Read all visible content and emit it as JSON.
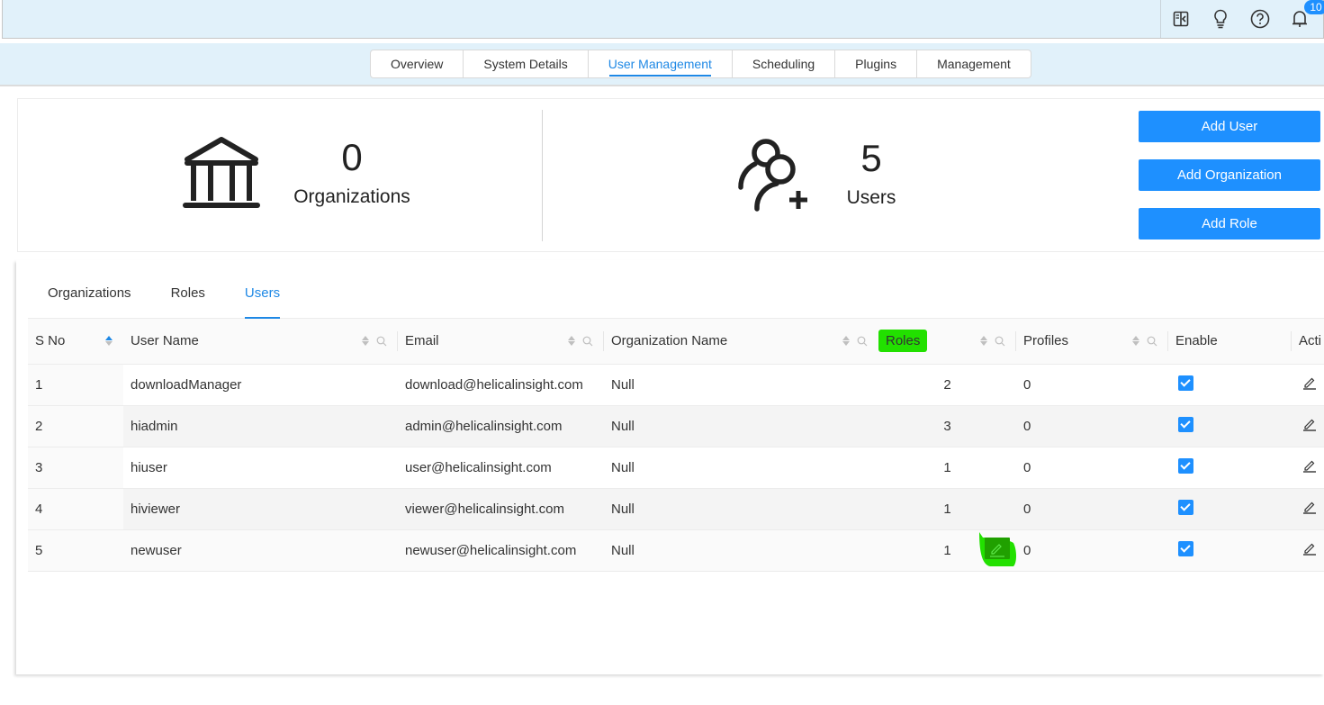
{
  "header": {
    "icons": [
      {
        "name": "panel-toggle-icon"
      },
      {
        "name": "lightbulb-icon"
      },
      {
        "name": "help-icon"
      },
      {
        "name": "notification-bell-icon"
      }
    ],
    "notification_count": "10"
  },
  "main_tabs": [
    {
      "label": "Overview",
      "active": false
    },
    {
      "label": "System Details",
      "active": false
    },
    {
      "label": "User Management",
      "active": true
    },
    {
      "label": "Scheduling",
      "active": false
    },
    {
      "label": "Plugins",
      "active": false
    },
    {
      "label": "Management",
      "active": false
    }
  ],
  "summary": {
    "organizations": {
      "count": "0",
      "label": "Organizations",
      "icon": "institution-icon"
    },
    "users": {
      "count": "5",
      "label": "Users",
      "icon": "users-add-icon"
    }
  },
  "actions": {
    "add_user": "Add User",
    "add_organization": "Add Organization",
    "add_role": "Add Role"
  },
  "sub_tabs": [
    {
      "label": "Organizations",
      "active": false
    },
    {
      "label": "Roles",
      "active": false
    },
    {
      "label": "Users",
      "active": true
    }
  ],
  "table": {
    "columns": [
      {
        "label": "S No",
        "sort": "asc"
      },
      {
        "label": "User Name",
        "sort": "none",
        "filter": true
      },
      {
        "label": "Email",
        "sort": "none",
        "filter": true
      },
      {
        "label": "Organization Name",
        "sort": "none",
        "filter": true
      },
      {
        "label": "Roles",
        "sort": "none",
        "filter": true,
        "highlighted": true
      },
      {
        "label": "Profiles",
        "sort": "none",
        "filter": true
      },
      {
        "label": "Enable"
      },
      {
        "label": "Acti"
      }
    ],
    "rows": [
      {
        "sno": "1",
        "username": "downloadManager",
        "email": "download@helicalinsight.com",
        "org": "Null",
        "roles": "2",
        "profiles": "0",
        "enabled": true
      },
      {
        "sno": "2",
        "username": "hiadmin",
        "email": "admin@helicalinsight.com",
        "org": "Null",
        "roles": "3",
        "profiles": "0",
        "enabled": true
      },
      {
        "sno": "3",
        "username": "hiuser",
        "email": "user@helicalinsight.com",
        "org": "Null",
        "roles": "1",
        "profiles": "0",
        "enabled": true
      },
      {
        "sno": "4",
        "username": "hiviewer",
        "email": "viewer@helicalinsight.com",
        "org": "Null",
        "roles": "1",
        "profiles": "0",
        "enabled": true
      },
      {
        "sno": "5",
        "username": "newuser",
        "email": "newuser@helicalinsight.com",
        "org": "Null",
        "roles": "1",
        "profiles": "0",
        "enabled": true
      }
    ]
  },
  "colors": {
    "accent": "#1e88e5",
    "button": "#1e90ff",
    "header_bg": "#e1f1fa",
    "highlight": "#22e000"
  }
}
